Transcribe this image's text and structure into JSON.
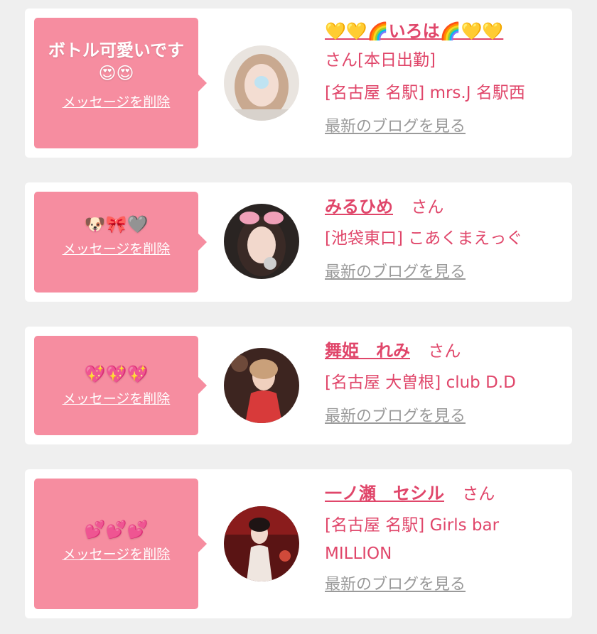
{
  "cards": [
    {
      "message": "ボトル可愛いです😍😍",
      "delete_label": "メッセージを削除",
      "name": "💛💛🌈いろは🌈💛💛",
      "honorific": "さん[本日出勤]",
      "shop": "[名古屋 名駅] mrs.J 名駅西",
      "blog_label": "最新のブログを見る"
    },
    {
      "message": "🐶🎀🩶",
      "delete_label": "メッセージを削除",
      "name": "みるひめ",
      "honorific": "さん",
      "shop": "[池袋東口] こあくまえっぐ",
      "blog_label": "最新のブログを見る"
    },
    {
      "message": "💖💖💖",
      "delete_label": "メッセージを削除",
      "name": "舞姫　れみ",
      "honorific": "さん",
      "shop": "[名古屋 大曽根] club D.D",
      "blog_label": "最新のブログを見る"
    },
    {
      "message": "💕💕💕",
      "delete_label": "メッセージを削除",
      "name": "一ノ瀬　セシル",
      "honorific": "さん",
      "shop": "[名古屋 名駅] Girls bar MILLION",
      "blog_label": "最新のブログを見る"
    }
  ],
  "colors": {
    "bubble": "#f68da0",
    "name": "#e0466a",
    "link_gray": "#9a9a9a",
    "background": "#efefef"
  }
}
